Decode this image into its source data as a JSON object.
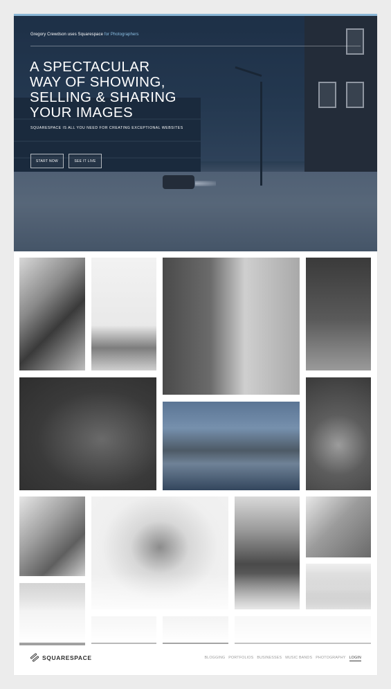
{
  "hero": {
    "byline_prefix": "Gregory Crewdson uses Squarespace ",
    "byline_link": "for Photographers",
    "headline": [
      "A SPECTACULAR",
      "WAY OF SHOWING,",
      "SELLING & SHARING",
      "YOUR IMAGES"
    ],
    "subline": "SQUARESPACE IS ALL YOU NEED FOR CREATING EXCEPTIONAL WEBSITES",
    "buttons": {
      "start": "START NOW",
      "live": "SEE IT LIVE"
    },
    "colors": {
      "accent": "#8ec2e6",
      "top_line": "#8ab6d6"
    }
  },
  "gallery": {
    "tiles": [
      "two-men-photo",
      "misty-mountains-photo",
      "woman-on-rocky-shore-photo",
      "selfie-in-mirror-photo",
      "woman-riding-hyena-photo",
      "snowy-street-dusk-photo",
      "peacock-illustration",
      "women-laughing-photo",
      "owl-illustration",
      "men-in-suits-photo",
      "rock-sculpture-photo",
      "man-in-white-room-photo",
      "phone-closeup-photo",
      "man-portrait-photo",
      "tie-closeup-photo",
      "landscape-photo"
    ]
  },
  "footer": {
    "logo_text": "SQUARESPACE",
    "logo_icon": "squarespace-logo-icon",
    "nav": [
      "BLOGGING",
      "PORTFOLIOS",
      "BUSINESSES",
      "MUSIC BANDS",
      "PHOTOGRAPHY"
    ],
    "login": "LOGIN"
  }
}
